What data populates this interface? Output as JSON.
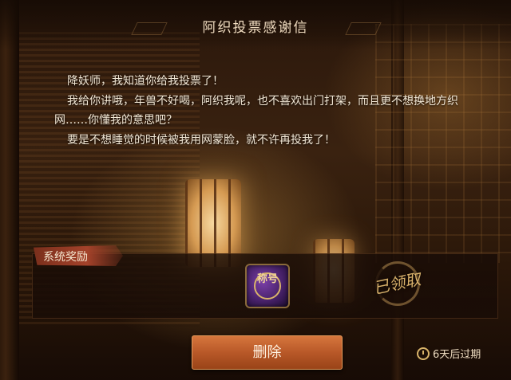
{
  "header": {
    "title": "阿织投票感谢信"
  },
  "letter": {
    "lines": [
      "降妖师，我知道你给我投票了！",
      "我给你讲哦，年兽不好喝，阿织我呢，也不喜欢出门打架，而且更不想换地方织网……你懂我的意思吧？",
      "要是不想睡觉的时候被我用网蒙脸，就不许再投我了！"
    ]
  },
  "reward": {
    "label": "系统奖励",
    "item_text": "称号",
    "claimed_text": "已领取"
  },
  "actions": {
    "delete_label": "删除"
  },
  "expiry": {
    "text": "6天后过期"
  },
  "colors": {
    "accent": "#b85828",
    "gold": "#d9b46a",
    "text": "#f3e8d6"
  },
  "icons": {
    "reward_item": "title-badge-icon",
    "claimed_stamp": "claimed-stamp-icon",
    "expiry": "clock-icon"
  }
}
